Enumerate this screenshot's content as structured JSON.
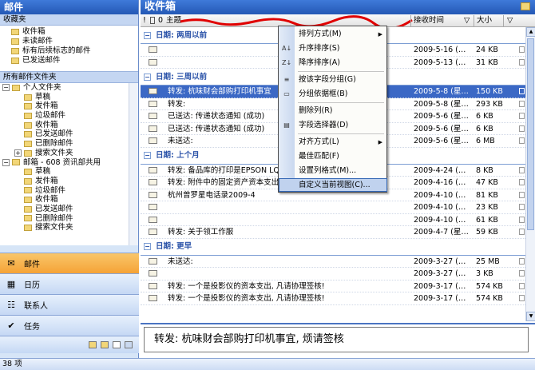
{
  "nav": {
    "title": "邮件",
    "favorites_header": "收藏夹",
    "favorites": [
      "收件箱",
      "未读邮件",
      "标有后续标志的邮件",
      "已发送邮件"
    ],
    "all_folders_header": "所有邮件文件夹",
    "personal_root": "个人文件夹",
    "personal_folders": [
      "草稿",
      "发件箱",
      "垃圾邮件",
      "收件箱",
      "已发送邮件",
      "已删除邮件",
      "搜索文件夹"
    ],
    "mailbox_root": "邮箱 - 608 资讯部共用",
    "mailbox_folders": [
      "草稿",
      "发件箱",
      "垃圾邮件",
      "收件箱",
      "已发送邮件",
      "已删除邮件",
      "搜索文件夹"
    ],
    "buttons": [
      {
        "label": "邮件",
        "icon": "mail-icon",
        "active": true
      },
      {
        "label": "日历",
        "icon": "calendar-icon",
        "active": false
      },
      {
        "label": "联系人",
        "icon": "contacts-icon",
        "active": false
      },
      {
        "label": "任务",
        "icon": "tasks-icon",
        "active": false
      }
    ],
    "tree_plus": "+",
    "tree_minus": "−"
  },
  "inbox": {
    "title": "收件箱",
    "col_subject": "主题",
    "col_received": "接收时间",
    "col_size": "大小",
    "col_sort_arrow": "▽",
    "col_flag": "▽",
    "col_icon_marks": "! ⎕ 0",
    "groups": [
      {
        "label": "日期: 两周以前",
        "rows": [
          {
            "subject": "",
            "received": "2009-5-16 (…",
            "size": "24 KB"
          },
          {
            "subject": "",
            "received": "2009-5-13 (…",
            "size": "31 KB"
          }
        ]
      },
      {
        "label": "日期: 三周以前",
        "rows": [
          {
            "subject": "转发: 杭味财会部购打印机事宜",
            "received": "2009-5-8 (星…",
            "size": "150 KB",
            "selected": true
          },
          {
            "subject": "转发:",
            "received": "2009-5-8 (星…",
            "size": "293 KB"
          },
          {
            "subject": "已送达: 传递状态通知 (成功)",
            "received": "2009-5-6 (星…",
            "size": "6 KB"
          },
          {
            "subject": "已送达: 传递状态通知 (成功)",
            "received": "2009-5-6 (星…",
            "size": "6 KB"
          },
          {
            "subject": "未送达:",
            "received": "2009-5-6 (星…",
            "size": "6 MB"
          }
        ]
      },
      {
        "label": "日期: 上个月",
        "rows": [
          {
            "subject": "转发: 备品库的打印是EPSON LQ-",
            "received": "2009-4-24 (…",
            "size": "8 KB"
          },
          {
            "subject": "转发: 附件中的固定资产资本支出表请审核!",
            "received": "2009-4-16 (…",
            "size": "47 KB"
          },
          {
            "subject": "杭州曾罗星电话录2009-4",
            "received": "2009-4-10 (…",
            "size": "81 KB"
          },
          {
            "subject": "",
            "received": "2009-4-10 (…",
            "size": "23 KB"
          },
          {
            "subject": "",
            "received": "2009-4-10 (…",
            "size": "61 KB"
          },
          {
            "subject": "转发: 关于领工作服",
            "received": "2009-4-7 (星…",
            "size": "59 KB"
          }
        ]
      },
      {
        "label": "日期: 更早",
        "rows": [
          {
            "subject": "未送达:",
            "received": "2009-3-27 (…",
            "size": "25 MB"
          },
          {
            "subject": "",
            "received": "2009-3-27 (…",
            "size": "3 KB"
          },
          {
            "subject": "转发: 一个是投影仪的资本支出, 凡请协理签核!",
            "received": "2009-3-17 (…",
            "size": "574 KB"
          },
          {
            "subject": "转发: 一个是投影仪的资本支出, 凡请协理签核!",
            "received": "2009-3-17 (…",
            "size": "574 KB"
          }
        ]
      }
    ]
  },
  "preview": {
    "subject": "转发: 杭味财会部购打印机事宜, 烦请签核"
  },
  "context_menu": {
    "items": [
      {
        "label": "排列方式(M)",
        "submenu": true
      },
      {
        "label": "升序排序(S)"
      },
      {
        "label": "降序排序(A)"
      },
      {
        "label": "按该字段分组(G)"
      },
      {
        "label": "分组依据框(B)"
      },
      {
        "label": "删除列(R)"
      },
      {
        "label": "字段选择器(D)"
      },
      {
        "label": "对齐方式(L)",
        "submenu": true
      },
      {
        "label": "最佳匹配(F)"
      },
      {
        "label": "设置列格式(M)..."
      },
      {
        "label": "自定义当前视图(C)...",
        "highlighted": true
      }
    ]
  },
  "status": {
    "text": "38 项"
  },
  "colors": {
    "accent": "#2458b5",
    "selection": "#3b68c5",
    "annotation": "#e00000"
  }
}
